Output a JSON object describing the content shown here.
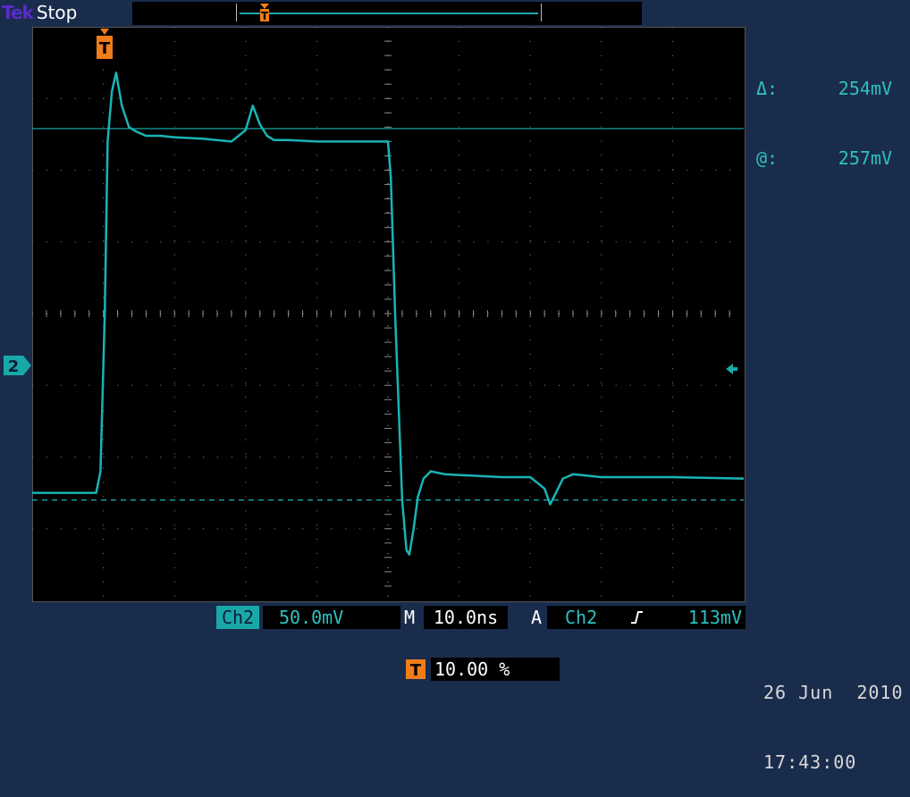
{
  "header": {
    "brand": "Tek",
    "acquisition_state": "Stop"
  },
  "cursor_readout": {
    "delta_label": "Δ:",
    "delta_value": "254mV",
    "at_label": "@:",
    "at_value": "257mV"
  },
  "channel_marker": {
    "label": "2"
  },
  "trigger_marker": {
    "label": "T"
  },
  "status": {
    "channel": "Ch2",
    "volts_per_div": "50.0mV",
    "timebase_label": "M",
    "time_per_div": "10.0ns",
    "trigger_label": "A",
    "trigger_source": "Ch2",
    "trigger_slope_icon": "rising-edge-icon",
    "trigger_level": "113mV"
  },
  "horizontal_position": {
    "value": "10.00 %"
  },
  "datetime": {
    "date": "26 Jun  2010",
    "time": "17:43:00"
  },
  "colors": {
    "trace": "#19b4b4",
    "trigger": "#f07c1a",
    "grid": "#888888",
    "background": "#000000",
    "frame": "#1a2c4c"
  },
  "chart_data": {
    "type": "line",
    "title": "",
    "xlabel": "",
    "ylabel": "",
    "x_unit": "ns",
    "y_unit": "mV",
    "x_divisions": 10,
    "y_divisions": 8,
    "xlim": [
      -10,
      90
    ],
    "ylim": [
      -200,
      200
    ],
    "grid": true,
    "series": [
      {
        "x": [
          -10,
          -1.0,
          -0.4,
          0.2,
          0.6,
          1.2,
          1.8,
          2.6,
          3.6,
          4.6,
          6,
          8,
          10,
          14,
          18,
          20,
          21,
          22,
          23,
          24,
          26,
          30,
          34,
          38,
          40,
          40.4,
          41,
          42,
          42.6,
          43,
          43.6,
          44.2,
          45,
          46,
          48,
          52,
          56,
          60,
          62,
          62.8,
          63.6,
          64.6,
          66,
          70,
          80,
          90
        ],
        "y": [
          -125,
          -125,
          -110,
          0,
          120,
          155,
          168,
          145,
          130,
          127,
          124,
          124,
          123,
          122,
          120,
          128,
          145,
          132,
          124,
          121,
          121,
          120,
          120,
          120,
          120,
          95,
          0,
          -130,
          -165,
          -168,
          -150,
          -128,
          -115,
          -110,
          -112,
          -113,
          -114,
          -114,
          -122,
          -133,
          -125,
          -115,
          -112,
          -114,
          -114,
          -115
        ]
      }
    ],
    "reference_lines": [
      {
        "orientation": "horizontal",
        "y": -130,
        "style": "dashed"
      },
      {
        "orientation": "horizontal",
        "y": 129,
        "style": "solid"
      }
    ]
  }
}
